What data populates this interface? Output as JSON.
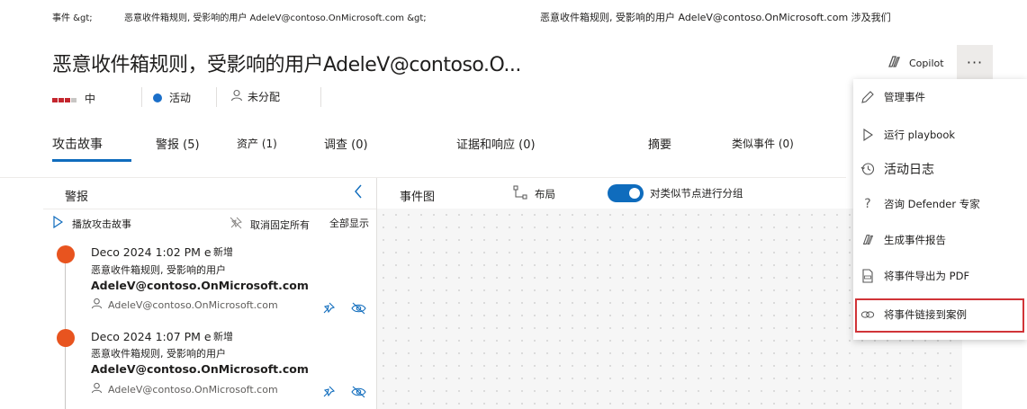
{
  "breadcrumb": {
    "part1": "事件 &gt;",
    "part2": "恶意收件箱规则, 受影响的用户 AdeleV@contoso.OnMicrosoft.com &gt;",
    "part3": "恶意收件箱规则, 受影响的用户 AdeleV@contoso.OnMicrosoft.com 涉及我们"
  },
  "incident": {
    "title": "恶意收件箱规则，受影响的用户AdeleV@contoso.O...",
    "severity": "中",
    "status": "活动",
    "assigned": "未分配"
  },
  "header": {
    "copilot_label": "Copilot",
    "more_label": "···"
  },
  "tabs": [
    {
      "label": "攻击故事"
    },
    {
      "label": "警报 (5)"
    },
    {
      "label": "资产 (1)"
    },
    {
      "label": "调查 (0)"
    },
    {
      "label": "证据和响应 (0)"
    },
    {
      "label": "摘要"
    },
    {
      "label": "类似事件 (0)"
    }
  ],
  "alerts_panel": {
    "title": "警报",
    "play_label": "播放攻击故事",
    "unpin_label": "取消固定所有",
    "show_all_label": "全部显示",
    "items": [
      {
        "time": "Deco 2024 1:02 PM e",
        "status": "新增",
        "title": "恶意收件箱规则, 受影响的用户",
        "subject": "AdeleV@contoso.OnMicrosoft.com",
        "user": "AdeleV@contoso.OnMicrosoft.com"
      },
      {
        "time": "Deco 2024 1:07 PM e",
        "status": "新增",
        "title": "恶意收件箱规则, 受影响的用户",
        "subject": "AdeleV@contoso.OnMicrosoft.com",
        "user": "AdeleV@contoso.OnMicrosoft.com"
      }
    ]
  },
  "graph": {
    "title": "事件图",
    "layout_label": "布局",
    "group_label": "对类似节点进行分组",
    "group_enabled": true
  },
  "menu": {
    "items": [
      {
        "label": "管理事件",
        "icon": "pencil-icon"
      },
      {
        "label": "运行 playbook",
        "icon": "play-icon"
      },
      {
        "label": "活动日志",
        "icon": "history-icon"
      },
      {
        "label": "咨询 Defender 专家",
        "icon": "question-icon"
      },
      {
        "label": "生成事件报告",
        "icon": "copilot-icon"
      },
      {
        "label": "将事件导出为 PDF",
        "icon": "pdf-icon"
      },
      {
        "label": "将事件链接到案例",
        "icon": "link-icon"
      }
    ]
  },
  "colors": {
    "accent": "#0f6cbd",
    "severity": "#c4262e",
    "alert_dot": "#e8541f",
    "highlight": "#d13438"
  }
}
